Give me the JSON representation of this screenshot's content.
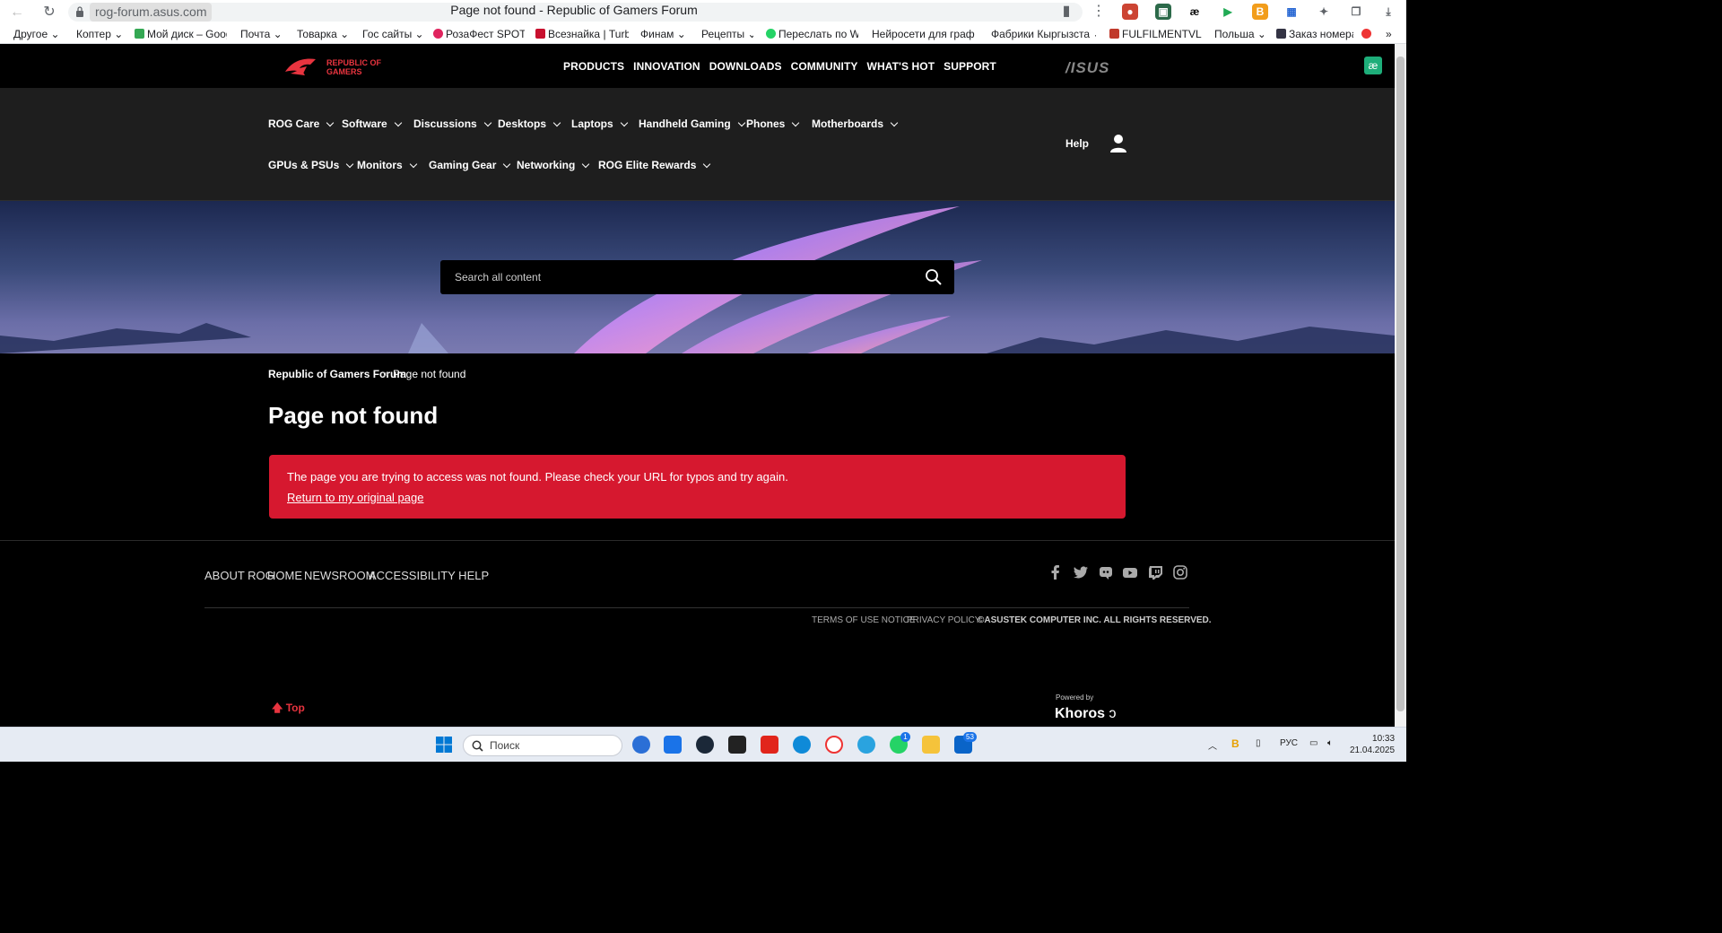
{
  "browser": {
    "url": "rog-forum.asus.com",
    "tab_title": "Page not found - Republic of Gamers Forum",
    "bookmarks": [
      "Другое",
      "Коптер",
      "Мой диск – Googl",
      "Почта",
      "Товарка",
      "Гос сайты",
      "РозаФест SPOTW",
      "Всезнайка | Turbo",
      "Финам",
      "Рецепты",
      "Переслать по Wh",
      "Нейросети для граф",
      "Фабрики Кыргызста",
      "FULFILMENTVL -",
      "Польша",
      "Заказ номера"
    ]
  },
  "rog": {
    "logo_text": "REPUBLIC OF GAMERS",
    "top_nav": [
      "PRODUCTS",
      "INNOVATION",
      "DOWNLOADS",
      "COMMUNITY",
      "WHAT'S HOT",
      "SUPPORT"
    ],
    "asus_logo": "/ISUS",
    "ae_badge": "æ",
    "categories_row1": [
      "ROG Care",
      "Software",
      "Discussions",
      "Desktops",
      "Laptops",
      "Handheld Gaming",
      "Phones",
      "Motherboards"
    ],
    "categories_row2": [
      "GPUs & PSUs",
      "Monitors",
      "Gaming Gear",
      "Networking",
      "ROG Elite Rewards"
    ],
    "help": "Help",
    "search_placeholder": "Search all content"
  },
  "breadcrumb": {
    "home": "Republic of Gamers Forum",
    "sep": ">",
    "current": "Page not found"
  },
  "page": {
    "title": "Page not found",
    "message": "The page you are trying to access was not found. Please check your URL for typos and try again.",
    "return_link": "Return to my original page"
  },
  "footer": {
    "links": [
      "ABOUT ROG",
      "HOME",
      "NEWSROOM",
      "ACCESSIBILITY HELP"
    ],
    "legal": [
      "TERMS OF USE NOTICE",
      "PRIVACY POLICY",
      "©ASUSTEK COMPUTER INC. ALL RIGHTS RESERVED."
    ],
    "top": "Top",
    "powered_by": "Powered by",
    "khoros": "Khoros"
  },
  "taskbar": {
    "search_label": "Поиск",
    "lang": "РУС",
    "time": "10:33",
    "date": "21.04.2025",
    "telegram_badge": "1",
    "mail_badge": "53"
  },
  "colors": {
    "accent": "#d6182f",
    "rog_red": "#e8343f"
  }
}
